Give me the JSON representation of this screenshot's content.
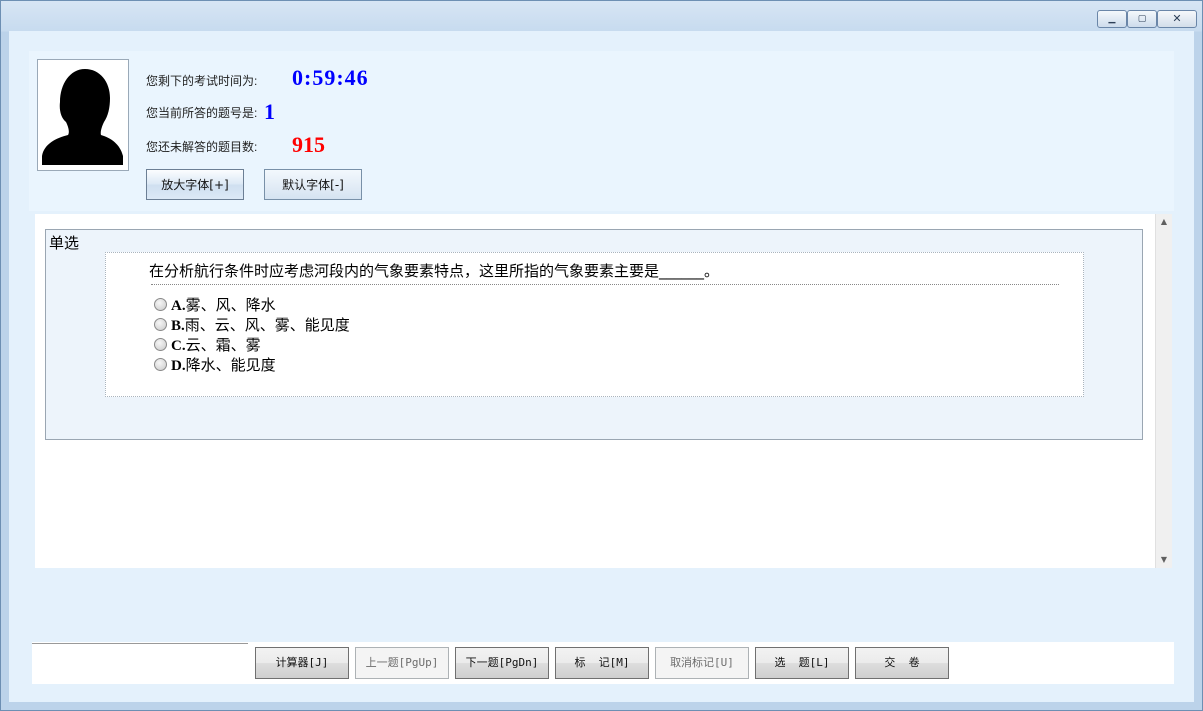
{
  "window": {
    "controls": {
      "minimize": "▁",
      "maximize": "▢",
      "close": "✕"
    }
  },
  "header": {
    "time_label": "您剩下的考试时间为:",
    "time_value": "0:59:46",
    "current_label": "您当前所答的题号是:",
    "current_value": "1",
    "remaining_label": "您还未解答的题目数:",
    "remaining_value": "915",
    "zoom_button": "放大字体[+]",
    "default_button": "默认字体[-]"
  },
  "question": {
    "type": "单选",
    "text": "在分析航行条件时应考虑河段内的气象要素特点，这里所指的气象要素主要是______。",
    "options": [
      {
        "key": "A.",
        "text": "雾、风、降水"
      },
      {
        "key": "B.",
        "text": "雨、云、风、雾、能见度"
      },
      {
        "key": "C.",
        "text": "云、霜、雾"
      },
      {
        "key": "D.",
        "text": "降水、能见度"
      }
    ]
  },
  "footer": {
    "calculator": "计算器[J]",
    "prev": "上一题[PgUp]",
    "next": "下一题[PgDn]",
    "mark": "标  记[M]",
    "unmark": "取消标记[U]",
    "select": "选  题[L]",
    "submit": "交  卷"
  },
  "colors": {
    "timer": "#0000ff",
    "current": "#0000ff",
    "remaining": "#ff0000"
  }
}
